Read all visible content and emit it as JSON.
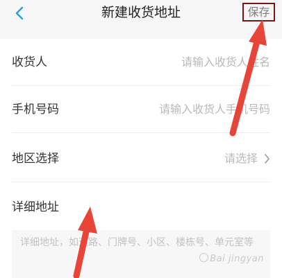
{
  "header": {
    "title": "新建收货地址",
    "save_label": "保存"
  },
  "form": {
    "receiver": {
      "label": "收货人",
      "placeholder": "请输入收货人姓名"
    },
    "phone": {
      "label": "手机号码",
      "placeholder": "请输入收货人手机号码"
    },
    "region": {
      "label": "地区选择",
      "placeholder": "请选择"
    },
    "detail": {
      "label": "详细地址",
      "placeholder": "详细地址，如道路、门牌号、小区、楼栋号、单元室等"
    }
  },
  "watermark": {
    "text": "Bai jingyan"
  },
  "icons": {
    "back": "chevron-left-icon",
    "region": "chevron-right-icon"
  },
  "colors": {
    "accent": "#2a9fd6",
    "annotation_red": "#e8453a",
    "highlight_border": "#7a1515"
  }
}
